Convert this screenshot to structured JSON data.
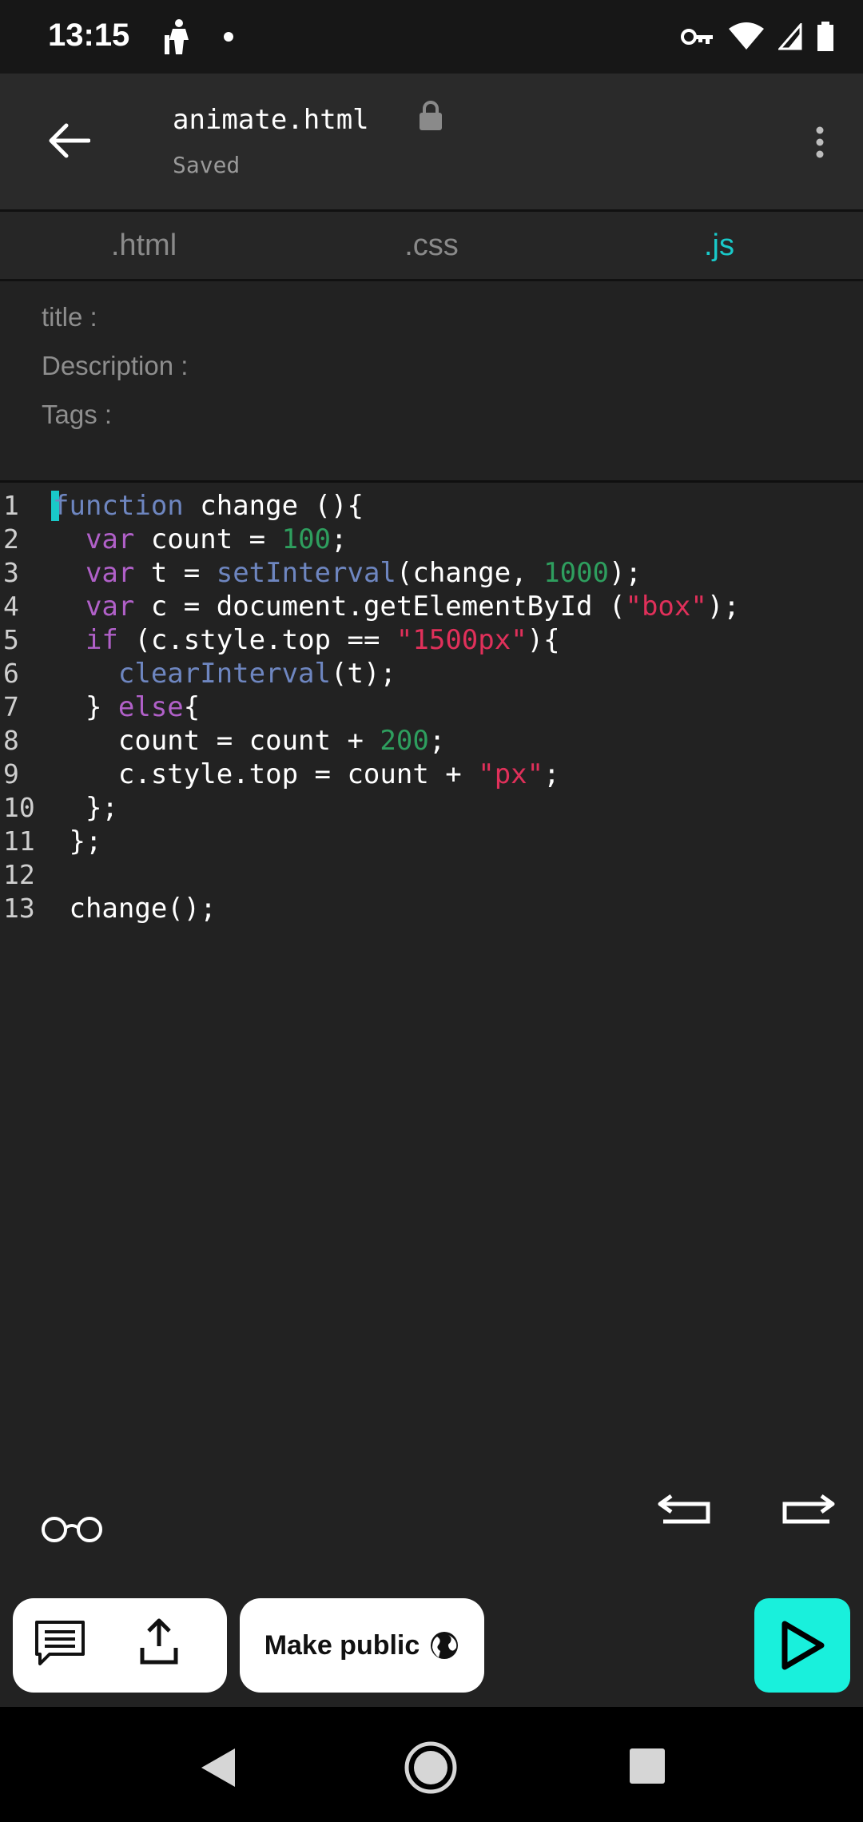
{
  "status_bar": {
    "time": "13:15",
    "icons": [
      "figure-icon",
      "notification-dot",
      "vpn-key-icon",
      "wifi-icon",
      "signal-icon",
      "battery-icon"
    ]
  },
  "app_bar": {
    "file_name": "animate.html",
    "save_status": "Saved",
    "icons": [
      "back-arrow-icon",
      "lock-icon",
      "more-vert-icon"
    ]
  },
  "tabs": [
    ".html",
    ".css",
    ".js"
  ],
  "active_tab": ".js",
  "meta": {
    "title_label": "title :",
    "description_label": "Description :",
    "tags_label": "Tags :"
  },
  "editor": {
    "line_numbers": [
      "1",
      "2",
      "3",
      "4",
      "5",
      "6",
      "7",
      "8",
      "9",
      "10",
      "11",
      "12",
      "13"
    ],
    "code_lines": [
      "function change (){",
      "  var count = 100;",
      "  var t = setInterval(change, 1000);",
      "  var c = document.getElementById (\"box\");",
      "  if (c.style.top == \"1500px\"){",
      "    clearInterval(t);",
      "  } else{",
      "    count = count + 200;",
      "    c.style.top = count + \"px\";",
      "  };",
      " };",
      "",
      " change();"
    ],
    "syntax_colors": {
      "keyword": "#b060c8",
      "function": "#6e86c0",
      "number": "#2e9e5e",
      "string": "#e0305a",
      "cursor": "#19c9c9"
    }
  },
  "toolbar": {
    "make_public_label": "Make public",
    "icons": [
      "glasses-icon",
      "undo-icon",
      "redo-icon",
      "comment-icon",
      "share-icon",
      "globe-icon",
      "play-icon"
    ]
  },
  "colors": {
    "accent": "#19c9c9",
    "run_button": "#19f0dc",
    "background": "#222222"
  }
}
